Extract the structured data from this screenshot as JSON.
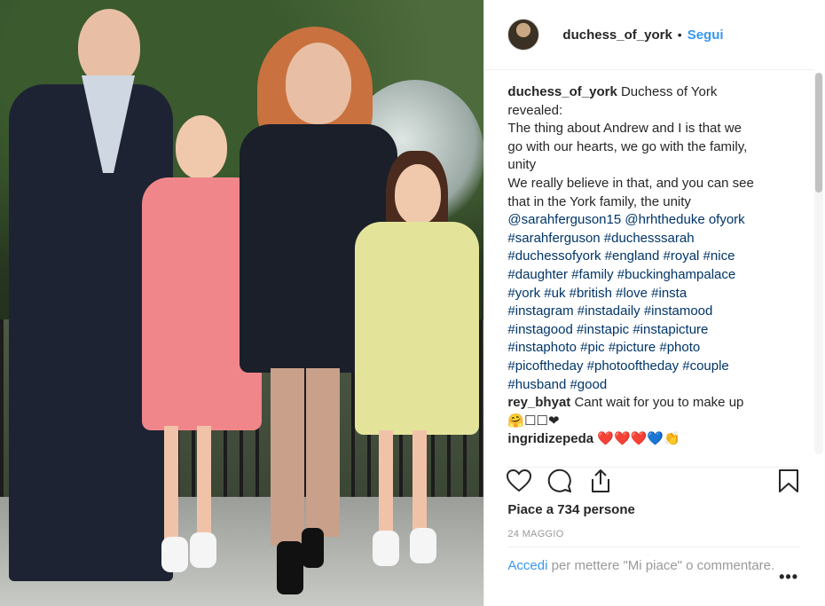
{
  "header": {
    "username": "duchess_of_york",
    "separator": "•",
    "follow_label": "Segui"
  },
  "caption": {
    "username": "duchess_of_york",
    "text_lines": [
      "Duchess of York",
      "revealed:",
      "The thing about Andrew and I is that we",
      "go with our hearts, we go with the family,",
      "unity",
      "We really believe in that, and you can see",
      "that in the York family, the unity"
    ],
    "tag_lines": [
      "@sarahferguson15 @hrhtheduke ofyork",
      "#sarahferguson #duchesssarah",
      "#duchessofyork #england #royal #nice",
      "#daughter #family #buckinghampalace",
      "#york #uk #british #love #insta",
      "#instagram #instadaily #instamood",
      "#instagood #instapic #instapicture",
      "#instaphoto #pic #picture #photo",
      "#picoftheday #photooftheday #couple",
      "#husband #good"
    ]
  },
  "comments": [
    {
      "username": "rey_bhyat",
      "text": "Cant wait for you to make up",
      "text2": "🤗☐☐❤"
    },
    {
      "username": "ingridizepeda",
      "text": "❤️❤️❤️💙👏"
    }
  ],
  "likes_text": "Piace a 734 persone",
  "date": "24 MAGGIO",
  "login": {
    "link": "Accedi",
    "rest": "per mettere \"Mi piace\" o commentare."
  },
  "more_label": "•••",
  "icons": [
    "heart-icon",
    "comment-icon",
    "share-icon",
    "bookmark-icon"
  ],
  "colors": {
    "link": "#3897f0",
    "tag": "#003569",
    "muted": "#999999"
  }
}
